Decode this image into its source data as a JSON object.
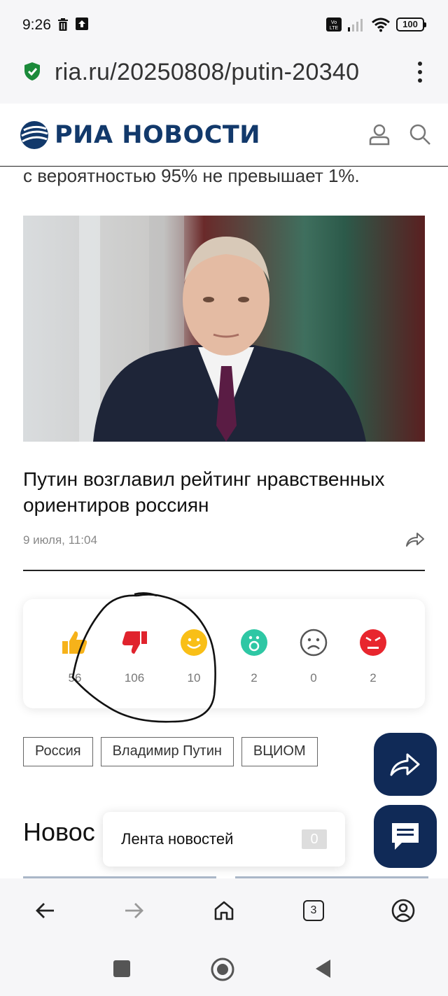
{
  "status_bar": {
    "time": "9:26",
    "battery": "100",
    "volte": "Vo LTE"
  },
  "address_bar": {
    "url": "ria.ru/20250808/putin-20340"
  },
  "site": {
    "logo_text": "РИА НОВОСТИ",
    "brand_color": "#12396b"
  },
  "article": {
    "tail_text": "с вероятностью 95% не превышает 1%.",
    "related_headline": "Путин возглавил рейтинг нравственных ориентиров россиян",
    "related_date": "9 июля, 11:04"
  },
  "reactions": [
    {
      "icon": "thumbs-up-icon",
      "count": "56",
      "color": "#f6b21a"
    },
    {
      "icon": "thumbs-down-icon",
      "count": "106",
      "color": "#e0232d"
    },
    {
      "icon": "smile-icon",
      "count": "10",
      "color": "#f9bf17"
    },
    {
      "icon": "surprised-icon",
      "count": "2",
      "color": "#2ec7a4"
    },
    {
      "icon": "sad-icon",
      "count": "0",
      "color": "#555555"
    },
    {
      "icon": "angry-icon",
      "count": "2",
      "color": "#e8262e"
    }
  ],
  "tags": [
    "Россия",
    "Владимир Путин",
    "ВЦИОМ"
  ],
  "news_section": {
    "heading": "Новос",
    "popup_label": "Лента новостей",
    "popup_count": "0"
  },
  "browser_toolbar": {
    "tabs_count": "3"
  }
}
